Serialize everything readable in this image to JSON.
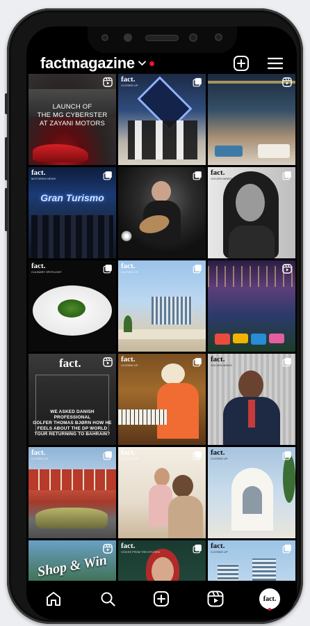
{
  "header": {
    "account_name": "factmagazine",
    "accent_color": "#e0173b"
  },
  "posts": [
    {
      "type": "reel",
      "tag": "",
      "caption": "LAUNCH OF\nTHE MG CYBERSTER\nAT ZAYANI MOTORS"
    },
    {
      "type": "carousel",
      "tag": "fact.",
      "sub": "CLOSING UP",
      "caption": ""
    },
    {
      "type": "reel",
      "tag": "",
      "caption": ""
    },
    {
      "type": "carousel",
      "tag": "fact.",
      "sub": "MOTORING NEWS",
      "caption": "Gran Turismo"
    },
    {
      "type": "carousel",
      "tag": "",
      "caption": ""
    },
    {
      "type": "carousel",
      "tag": "fact.",
      "sub": "GOLDEN MINDS",
      "caption": ""
    },
    {
      "type": "carousel",
      "tag": "fact.",
      "sub": "CULINARY SPOTLIGHT",
      "caption": ""
    },
    {
      "type": "carousel",
      "tag": "fact.",
      "sub": "CLOSING UP",
      "caption": ""
    },
    {
      "type": "reel",
      "tag": "",
      "caption": ""
    },
    {
      "type": "reel",
      "tag": "fact.",
      "caption": "WE ASKED DANISH PROFESSIONAL\nGOLFER THOMAS BJØRN HOW HE\nFEELS ABOUT THE DP WORLD\nTOUR RETURNING TO BAHRAIN?"
    },
    {
      "type": "carousel",
      "tag": "fact.",
      "sub": "CLOSING UP",
      "caption": ""
    },
    {
      "type": "carousel",
      "tag": "fact.",
      "sub": "GOLDEN MINDS",
      "caption": ""
    },
    {
      "type": "carousel",
      "tag": "fact.",
      "sub": "CLOSING UP",
      "caption": ""
    },
    {
      "type": "carousel",
      "tag": "fact.",
      "sub": "CLOSING UP",
      "caption": ""
    },
    {
      "type": "carousel",
      "tag": "fact.",
      "sub": "CLOSING UP",
      "caption": ""
    },
    {
      "type": "reel",
      "tag": "",
      "caption": "Shop & Win"
    },
    {
      "type": "carousel",
      "tag": "fact.",
      "sub": "VOICES FROM THE KITCHEN",
      "caption": ""
    },
    {
      "type": "carousel",
      "tag": "fact.",
      "sub": "CLOSING UP",
      "caption": ""
    }
  ],
  "nav": {
    "home_icon": "home-icon",
    "search_icon": "search-icon",
    "create_icon": "create-icon",
    "reels_icon": "reels-icon",
    "profile_label": "fact."
  }
}
